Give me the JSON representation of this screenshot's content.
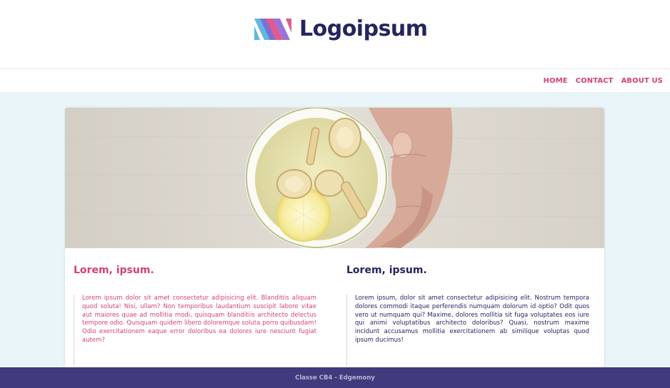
{
  "header": {
    "logo_text": "Logoipsum",
    "logo_icon": "logoipsum-stripes-icon"
  },
  "nav": {
    "items": [
      "HOME",
      "CONTACT",
      "ABOUT US"
    ]
  },
  "hero": {
    "image": "cup-of-ginger-lemon-tea-held-by-hand"
  },
  "columns": [
    {
      "heading": "Lorem, ipsum.",
      "text": "Lorem ipsum dolor sit amet consectetur adipisicing elit. Blanditiis aliquam quod soluta! Nisi, ullam? Non temporibus laudantium suscipit labore vitae aut maiores quae ad mollitia modi, quisquam blanditiis architecto delectus tempore odio. Quisquam quidem libero doloremque soluta porro quibusdam! Odio exercitationem eaque error doloribus ea dolores iure nesciunt fugiat autem?"
    },
    {
      "heading": "Lorem, ipsum.",
      "text": "Lorem ipsum, dolor sit amet consectetur adipisicing elit. Nostrum tempora dolores commodi itaque perferendis numquam dolorum id optio? Odit quos vero ut numquam qui? Maxime, dolores mollitia sit fuga voluptates eos iure qui animi voluptatibus architecto doloribus? Quasi, nostrum maxime incidunt accusamus mollitia exercitationem ab similique voluptas quod ipsum ducimus!"
    }
  ],
  "footer": {
    "text": "Classe CB4 - Edgemony"
  },
  "colors": {
    "accent_pink": "#d6416d",
    "navy": "#26245f",
    "footer_bg": "#3f3b7d",
    "page_bg": "#e9f5f8"
  }
}
